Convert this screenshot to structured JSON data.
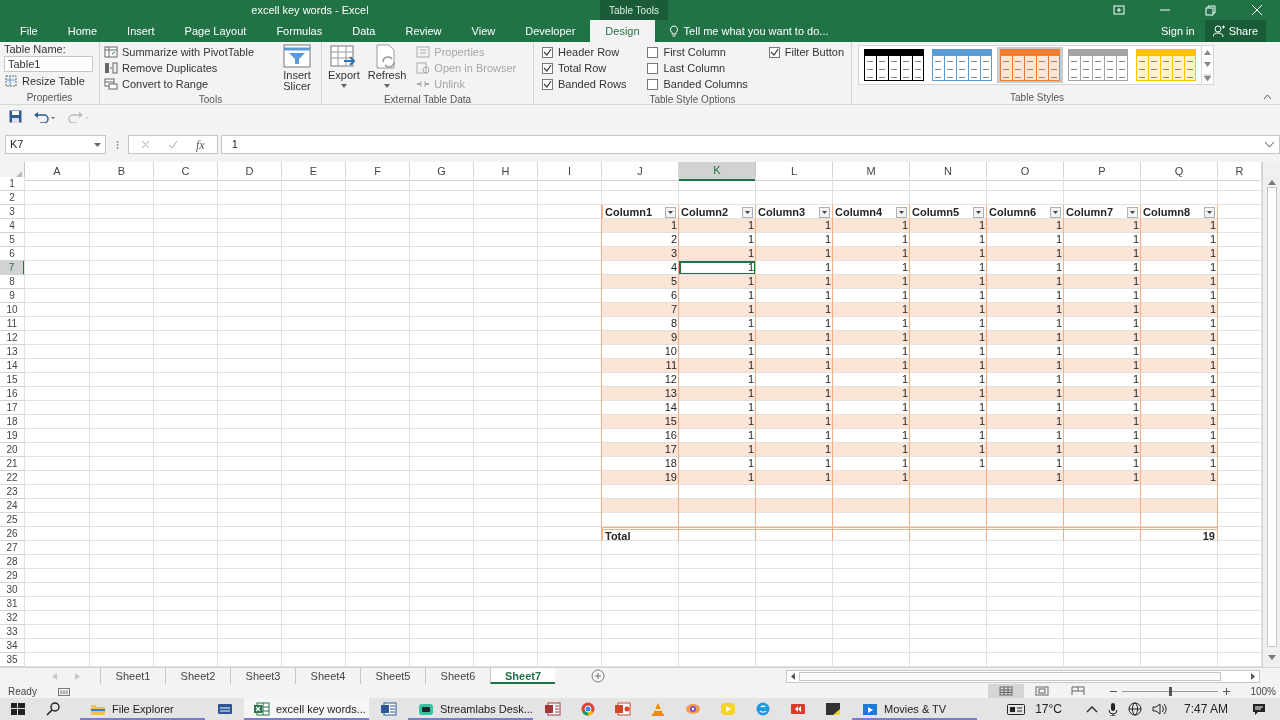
{
  "window": {
    "title": "excell key words - Excel",
    "context_tab": "Table Tools"
  },
  "ribbon_tabs": [
    {
      "label": "File",
      "selected": false
    },
    {
      "label": "Home",
      "selected": false
    },
    {
      "label": "Insert",
      "selected": false
    },
    {
      "label": "Page Layout",
      "selected": false
    },
    {
      "label": "Formulas",
      "selected": false
    },
    {
      "label": "Data",
      "selected": false
    },
    {
      "label": "Review",
      "selected": false
    },
    {
      "label": "View",
      "selected": false
    },
    {
      "label": "Developer",
      "selected": false
    },
    {
      "label": "Design",
      "selected": true
    }
  ],
  "tell_me": "Tell me what you want to do...",
  "sign_in": "Sign in",
  "share": "Share",
  "ribbon": {
    "properties": {
      "title": "Properties",
      "name_label": "Table Name:",
      "table_name": "Table1",
      "resize": "Resize Table"
    },
    "tools": {
      "title": "Tools",
      "items": [
        "Summarize with PivotTable",
        "Remove Duplicates",
        "Convert to Range"
      ],
      "slicer": "Insert Slicer"
    },
    "external": {
      "title": "External Table Data",
      "buttons": [
        "Export",
        "Refresh"
      ],
      "items": [
        {
          "label": "Properties",
          "disabled": true
        },
        {
          "label": "Open in Browser",
          "disabled": true
        },
        {
          "label": "Unlink",
          "disabled": true
        }
      ]
    },
    "style_options": {
      "title": "Table Style Options",
      "options": [
        {
          "label": "Header Row",
          "checked": true
        },
        {
          "label": "Total Row",
          "checked": true
        },
        {
          "label": "Banded Rows",
          "checked": true
        },
        {
          "label": "First Column",
          "checked": false
        },
        {
          "label": "Last Column",
          "checked": false
        },
        {
          "label": "Banded Columns",
          "checked": false
        },
        {
          "label": "Filter Button",
          "checked": true
        }
      ]
    },
    "table_styles": {
      "title": "Table Styles",
      "styles": [
        {
          "color": "#000000",
          "selected": false
        },
        {
          "color": "#5b9bd5",
          "selected": false
        },
        {
          "color": "#ed7d31",
          "selected": true
        },
        {
          "color": "#a5a5a5",
          "selected": false
        },
        {
          "color": "#ffc000",
          "selected": false
        }
      ]
    }
  },
  "name_box": "K7",
  "insert_function": "fx",
  "formula": "1",
  "columns": [
    {
      "label": "A",
      "selected": false
    },
    {
      "label": "B",
      "selected": false
    },
    {
      "label": "C",
      "selected": false
    },
    {
      "label": "D",
      "selected": false
    },
    {
      "label": "E",
      "selected": false
    },
    {
      "label": "F",
      "selected": false
    },
    {
      "label": "G",
      "selected": false
    },
    {
      "label": "H",
      "selected": false
    },
    {
      "label": "I",
      "selected": false
    },
    {
      "label": "J",
      "selected": false
    },
    {
      "label": "K",
      "selected": true
    },
    {
      "label": "L",
      "selected": false
    },
    {
      "label": "M",
      "selected": false
    },
    {
      "label": "N",
      "selected": false
    },
    {
      "label": "O",
      "selected": false
    },
    {
      "label": "P",
      "selected": false
    },
    {
      "label": "Q",
      "selected": false
    },
    {
      "label": "R",
      "selected": false
    }
  ],
  "rows": [
    {
      "label": "1",
      "selected": false
    },
    {
      "label": "2",
      "selected": false
    },
    {
      "label": "3",
      "selected": false
    },
    {
      "label": "4",
      "selected": false
    },
    {
      "label": "5",
      "selected": false
    },
    {
      "label": "6",
      "selected": false
    },
    {
      "label": "7",
      "selected": true
    },
    {
      "label": "8",
      "selected": false
    },
    {
      "label": "9",
      "selected": false
    },
    {
      "label": "10",
      "selected": false
    },
    {
      "label": "11",
      "selected": false
    },
    {
      "label": "12",
      "selected": false
    },
    {
      "label": "13",
      "selected": false
    },
    {
      "label": "14",
      "selected": false
    },
    {
      "label": "15",
      "selected": false
    },
    {
      "label": "16",
      "selected": false
    },
    {
      "label": "17",
      "selected": false
    },
    {
      "label": "18",
      "selected": false
    },
    {
      "label": "19",
      "selected": false
    },
    {
      "label": "20",
      "selected": false
    },
    {
      "label": "21",
      "selected": false
    },
    {
      "label": "22",
      "selected": false
    },
    {
      "label": "23",
      "selected": false
    },
    {
      "label": "24",
      "selected": false
    },
    {
      "label": "25",
      "selected": false
    },
    {
      "label": "26",
      "selected": false
    },
    {
      "label": "27",
      "selected": false
    },
    {
      "label": "28",
      "selected": false
    },
    {
      "label": "29",
      "selected": false
    },
    {
      "label": "30",
      "selected": false
    },
    {
      "label": "31",
      "selected": false
    },
    {
      "label": "32",
      "selected": false
    },
    {
      "label": "33",
      "selected": false
    },
    {
      "label": "34",
      "selected": false
    },
    {
      "label": "35",
      "selected": false
    }
  ],
  "table": {
    "headers": [
      "Column1",
      "Column2",
      "Column3",
      "Column4",
      "Column5",
      "Column6",
      "Column7",
      "Column8"
    ],
    "rows": [
      [
        "1",
        "1",
        "1",
        "1",
        "1",
        "1",
        "1",
        "1"
      ],
      [
        "2",
        "1",
        "1",
        "1",
        "1",
        "1",
        "1",
        "1"
      ],
      [
        "3",
        "1",
        "1",
        "1",
        "1",
        "1",
        "1",
        "1"
      ],
      [
        "4",
        "1",
        "1",
        "1",
        "1",
        "1",
        "1",
        "1"
      ],
      [
        "5",
        "1",
        "1",
        "1",
        "1",
        "1",
        "1",
        "1"
      ],
      [
        "6",
        "1",
        "1",
        "1",
        "1",
        "1",
        "1",
        "1"
      ],
      [
        "7",
        "1",
        "1",
        "1",
        "1",
        "1",
        "1",
        "1"
      ],
      [
        "8",
        "1",
        "1",
        "1",
        "1",
        "1",
        "1",
        "1"
      ],
      [
        "9",
        "1",
        "1",
        "1",
        "1",
        "1",
        "1",
        "1"
      ],
      [
        "10",
        "1",
        "1",
        "1",
        "1",
        "1",
        "1",
        "1"
      ],
      [
        "11",
        "1",
        "1",
        "1",
        "1",
        "1",
        "1",
        "1"
      ],
      [
        "12",
        "1",
        "1",
        "1",
        "1",
        "1",
        "1",
        "1"
      ],
      [
        "13",
        "1",
        "1",
        "1",
        "1",
        "1",
        "1",
        "1"
      ],
      [
        "14",
        "1",
        "1",
        "1",
        "1",
        "1",
        "1",
        "1"
      ],
      [
        "15",
        "1",
        "1",
        "1",
        "1",
        "1",
        "1",
        "1"
      ],
      [
        "16",
        "1",
        "1",
        "1",
        "1",
        "1",
        "1",
        "1"
      ],
      [
        "17",
        "1",
        "1",
        "1",
        "1",
        "1",
        "1",
        "1"
      ],
      [
        "18",
        "1",
        "1",
        "1",
        "1",
        "1",
        "1",
        "1"
      ],
      [
        "19",
        "1",
        "1",
        "1",
        null,
        "1",
        "1",
        "1"
      ],
      [
        null,
        null,
        null,
        null,
        null,
        null,
        null,
        null
      ],
      [
        null,
        null,
        null,
        null,
        null,
        null,
        null,
        null
      ],
      [
        null,
        null,
        null,
        null,
        null,
        null,
        null,
        null
      ]
    ],
    "total_label": "Total",
    "total_value": "19"
  },
  "sheet_tabs": [
    {
      "label": "Sheet1",
      "selected": false
    },
    {
      "label": "Sheet2",
      "selected": false
    },
    {
      "label": "Sheet3",
      "selected": false
    },
    {
      "label": "Sheet4",
      "selected": false
    },
    {
      "label": "Sheet5",
      "selected": false
    },
    {
      "label": "Sheet6",
      "selected": false
    },
    {
      "label": "Sheet7",
      "selected": true
    }
  ],
  "status": {
    "text": "Ready",
    "zoom": "100%",
    "zoom_slider": {
      "level": 0.5
    },
    "views": [
      {
        "kind": "normal",
        "selected": true
      },
      {
        "kind": "page_layout",
        "selected": false
      },
      {
        "kind": "page_break",
        "selected": false
      }
    ]
  },
  "taskbar": {
    "apps": [
      {
        "kind": "folder",
        "label": "File Explorer",
        "open": true,
        "active": false
      },
      {
        "kind": "task_view",
        "open": false,
        "active": false
      },
      {
        "kind": "spreadsheet",
        "label": "excell key words...",
        "open": true,
        "active": true
      },
      {
        "kind": "word",
        "open": false,
        "active": false
      },
      {
        "kind": "stream",
        "label": "Streamlabs Desk...",
        "open": true,
        "active": false
      },
      {
        "kind": "access",
        "open": false,
        "active": false
      },
      {
        "kind": "browser",
        "open": false,
        "active": false
      },
      {
        "kind": "slides",
        "open": false,
        "active": false
      },
      {
        "kind": "cone",
        "open": false,
        "active": false
      },
      {
        "kind": "eye",
        "open": false,
        "active": false
      },
      {
        "kind": "player",
        "open": false,
        "active": false
      },
      {
        "kind": "chat",
        "open": false,
        "active": false
      },
      {
        "kind": "media",
        "open": false,
        "active": false
      },
      {
        "kind": "note",
        "open": false,
        "active": false
      },
      {
        "kind": "movies",
        "label": "Movies & TV",
        "open": true,
        "active": false
      }
    ],
    "weather": "17°C",
    "time": "7:47 AM"
  }
}
